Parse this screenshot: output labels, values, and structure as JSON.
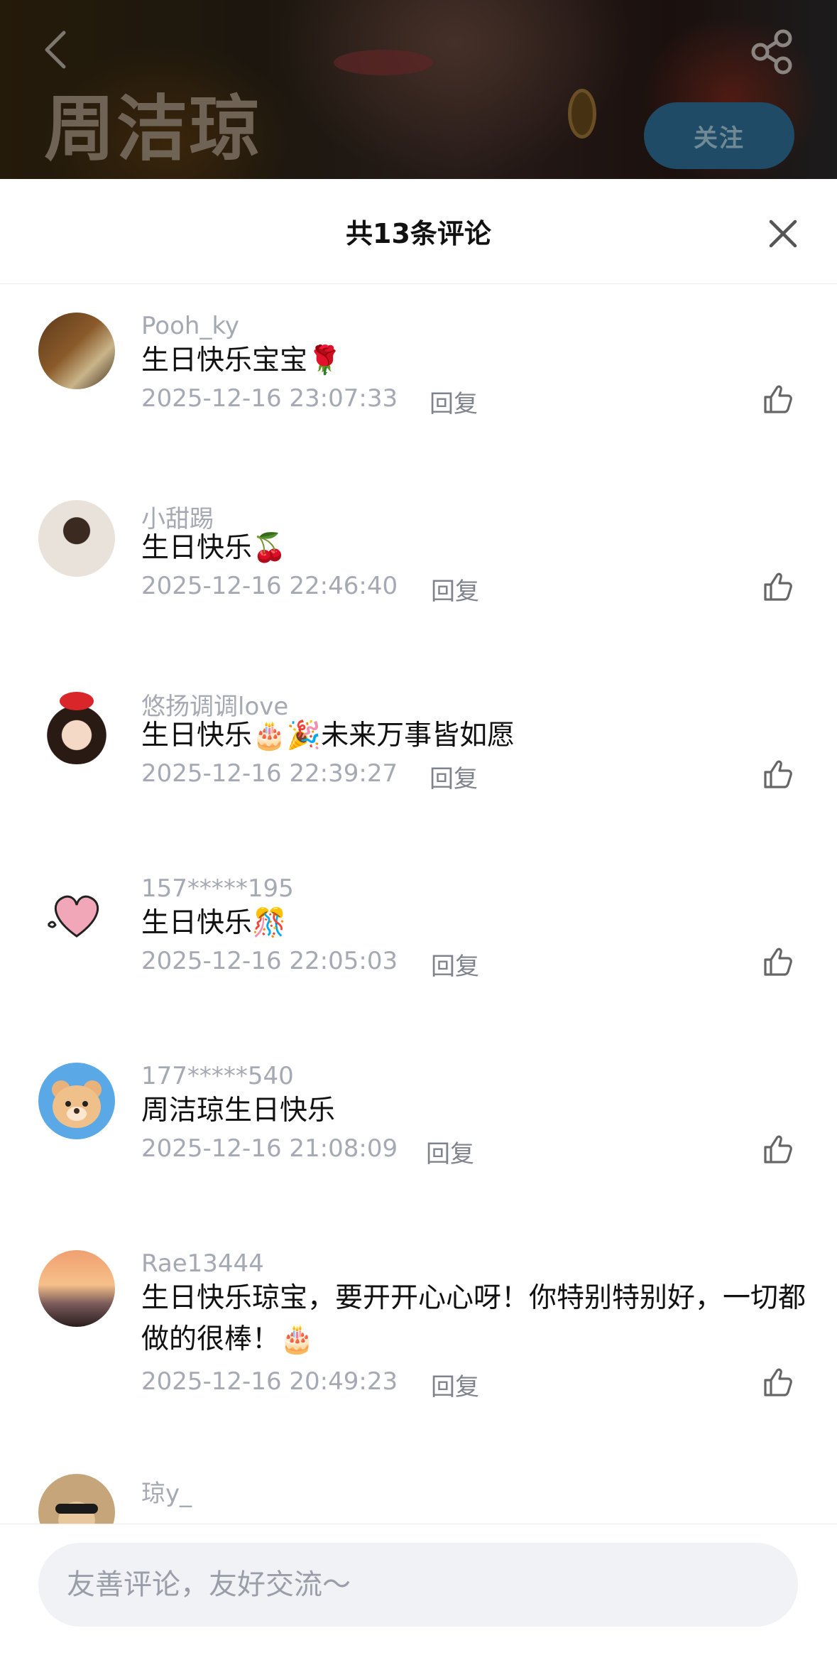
{
  "profile": {
    "name": "周洁琼",
    "follow_label": "关注"
  },
  "sheet": {
    "title": "共13条评论"
  },
  "comments": [
    {
      "name": "Pooh_ky",
      "text": "生日快乐宝宝🌹",
      "time": "2025-12-16 23:07:33",
      "reply": "回复"
    },
    {
      "name": "小甜踢",
      "text": "生日快乐🍒",
      "time": "2025-12-16 22:46:40",
      "reply": "回复"
    },
    {
      "name": "悠扬调调love",
      "text": "生日快乐🎂🎉未来万事皆如愿",
      "time": "2025-12-16 22:39:27",
      "reply": "回复"
    },
    {
      "name": "157*****195",
      "text": "生日快乐🎊",
      "time": "2025-12-16 22:05:03",
      "reply": "回复"
    },
    {
      "name": "177*****540",
      "text": "周洁琼生日快乐",
      "time": "2025-12-16 21:08:09",
      "reply": "回复"
    },
    {
      "name": "Rae13444",
      "text": "生日快乐琼宝，要开开心心呀！你特别特别好，一切都做的很棒！🎂",
      "time": "2025-12-16 20:49:23",
      "reply": "回复"
    },
    {
      "name": "琼y_"
    }
  ],
  "input": {
    "placeholder": "友善评论，友好交流～"
  },
  "colors": {
    "accent_dark": "#1f4b66",
    "muted_text": "#a5a9b3",
    "input_bg": "#f1f2f6"
  }
}
